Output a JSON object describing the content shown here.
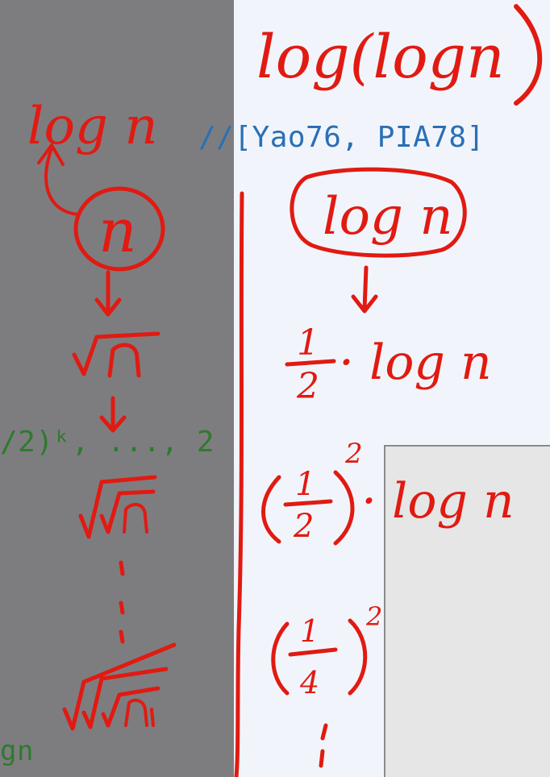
{
  "code": {
    "citation": "//[Yao76, PIA78]",
    "sequence_fragment": "/2)ᵏ, ..., 2",
    "tail_fragment": "gn"
  },
  "handwriting": {
    "top_title": "log(logn",
    "left_log": "log n",
    "left_node": "n",
    "right_node": "log n",
    "step_half": "· log n",
    "step_half_sq": "· log n",
    "exponent": "2",
    "fraction_num": "1",
    "fraction_den": "2",
    "fraction_den_b": "2",
    "fraction_num_c": "1",
    "fraction_den_c": "4"
  },
  "colors": {
    "ink": "#e11a12",
    "left_background": "#7d7d80",
    "right_background": "#f1f5fb",
    "citation": "#2a6fb5",
    "code_green": "#2f7a2f"
  }
}
